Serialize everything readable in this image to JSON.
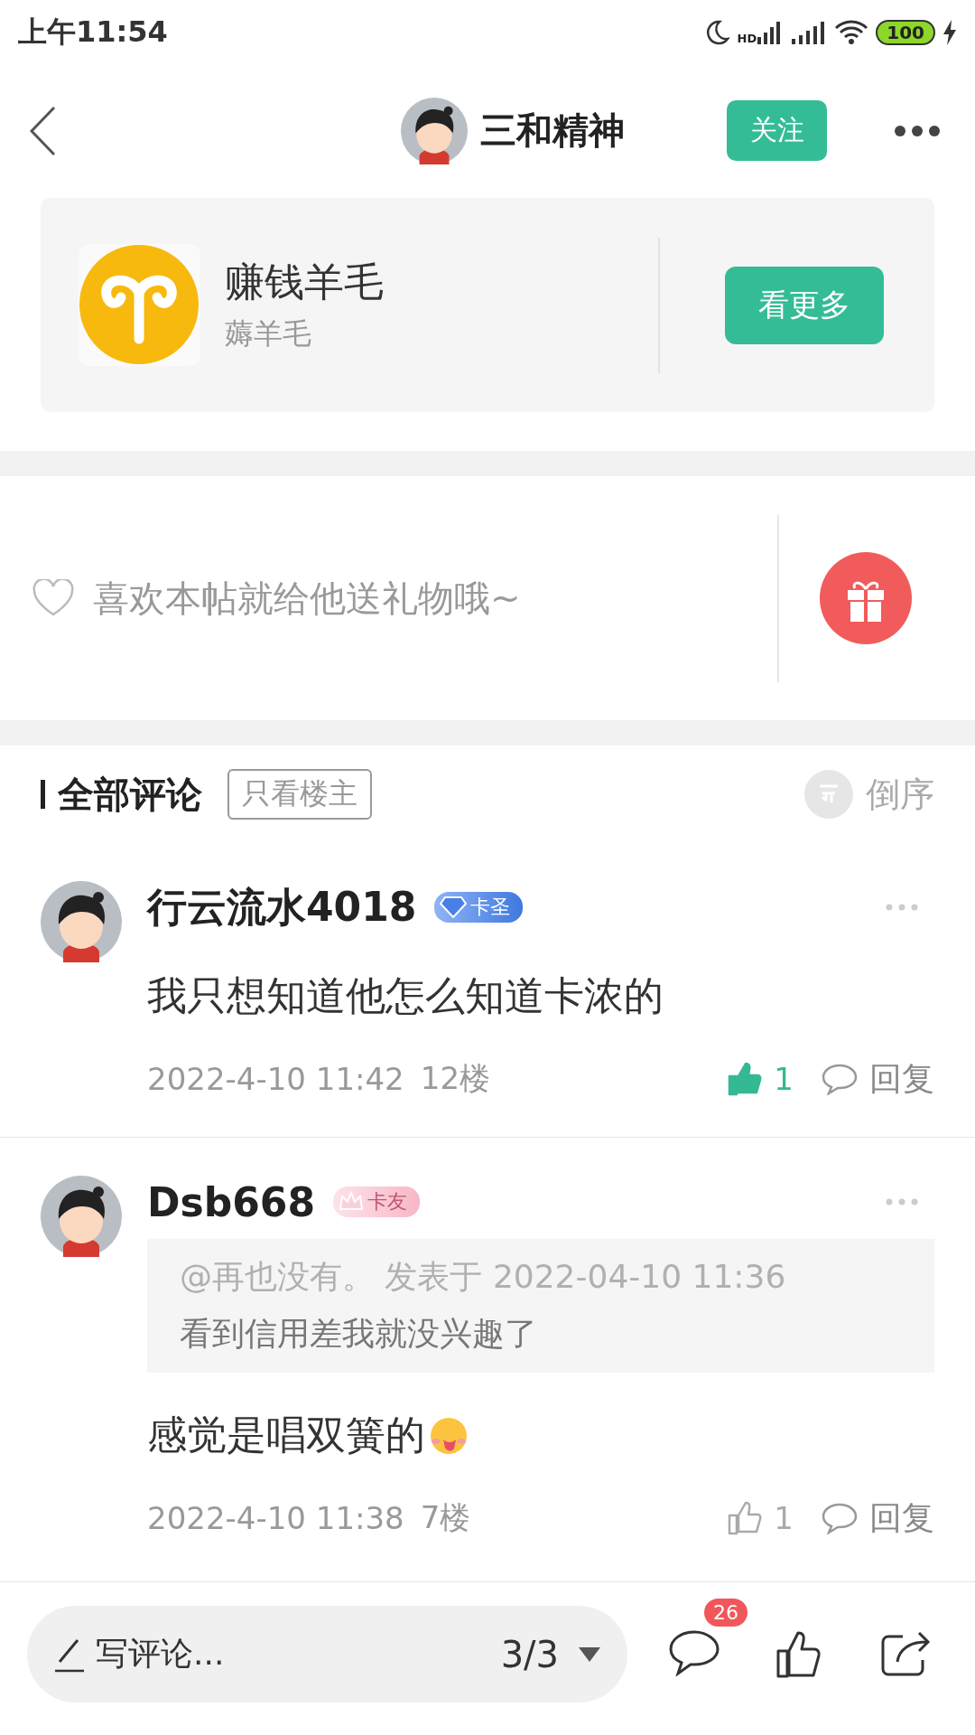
{
  "status_bar": {
    "time": "上午11:54",
    "network": "HD",
    "battery": "100"
  },
  "header": {
    "name": "三和精神",
    "follow": "关注"
  },
  "group_card": {
    "title": "赚钱羊毛",
    "subtitle": "薅羊毛",
    "button": "看更多"
  },
  "gift": {
    "prompt": "喜欢本帖就给他送礼物哦~"
  },
  "comments_header": {
    "title": "全部评论",
    "filter": "只看楼主",
    "filter_selected": false,
    "sort": "倒序"
  },
  "comments": [
    {
      "user": "行云流水4018",
      "badge": {
        "kind": "diamond",
        "label": "卡圣"
      },
      "text": "我只想知道他怎么知道卡浓的",
      "emoji": false,
      "time": "2022-4-10 11:42",
      "floor": "12楼",
      "liked": true,
      "likes": "1",
      "reply": "回复"
    },
    {
      "user": "Dsb668",
      "badge": {
        "kind": "crown",
        "label": "卡友"
      },
      "quote": {
        "head": "@再也没有。 发表于 2022-04-10 11:36",
        "text": "看到信用差我就没兴趣了"
      },
      "text": "感觉是唱双簧的",
      "emoji": true,
      "time": "2022-4-10 11:38",
      "floor": "7楼",
      "liked": false,
      "likes": "1",
      "reply": "回复"
    }
  ],
  "bottom_bar": {
    "placeholder": "写评论...",
    "page": "3/3",
    "comment_count": "26"
  }
}
